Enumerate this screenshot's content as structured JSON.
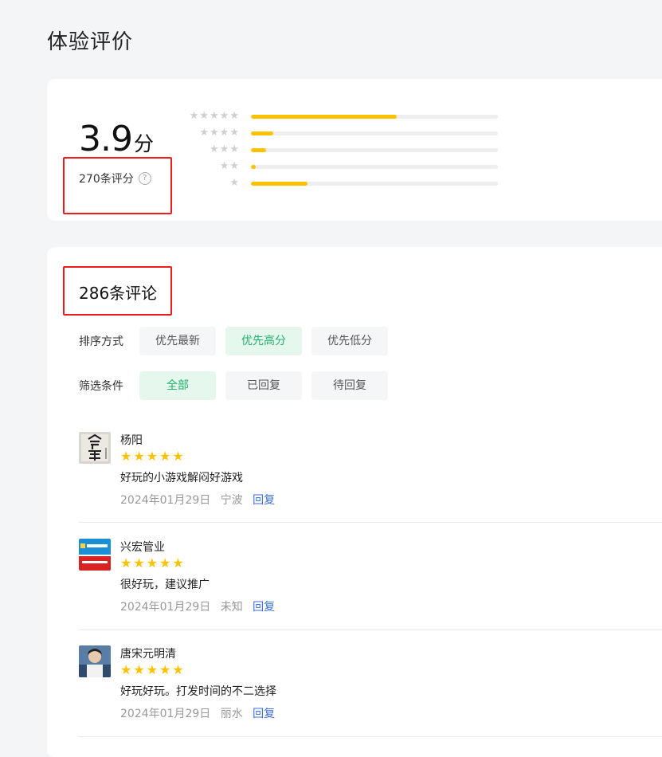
{
  "page": {
    "title": "体验评价"
  },
  "summary": {
    "score": "3.9",
    "score_unit": "分",
    "rating_count": "270条评分",
    "help_icon": "question-circle-icon",
    "distribution": [
      {
        "stars": "★★★★★",
        "fraction": 0.59
      },
      {
        "stars": "★★★★",
        "fraction": 0.09
      },
      {
        "stars": "★★★",
        "fraction": 0.06
      },
      {
        "stars": "★★",
        "fraction": 0.02
      },
      {
        "stars": "★",
        "fraction": 0.23
      }
    ],
    "bar_color": "#fcc200"
  },
  "reviews": {
    "title": "286条评论",
    "sort": {
      "label": "排序方式",
      "options": [
        "优先最新",
        "优先高分",
        "优先低分"
      ],
      "selected": "优先高分"
    },
    "filter": {
      "label": "筛选条件",
      "options": [
        "全部",
        "已回复",
        "待回复"
      ],
      "selected": "全部"
    },
    "accent": "#1fb36b",
    "items": [
      {
        "name": "杨阳",
        "stars": "★★★★★",
        "text": "好玩的小游戏解闷好游戏",
        "date": "2024年01月29日",
        "location": "宁波",
        "reply": "回复"
      },
      {
        "name": "兴宏管业",
        "stars": "★★★★★",
        "text": "很好玩，建议推广",
        "date": "2024年01月29日",
        "location": "未知",
        "reply": "回复"
      },
      {
        "name": "唐宋元明清",
        "stars": "★★★★★",
        "text": "好玩好玩。打发时间的不二选择",
        "date": "2024年01月29日",
        "location": "丽水",
        "reply": "回复"
      }
    ]
  }
}
